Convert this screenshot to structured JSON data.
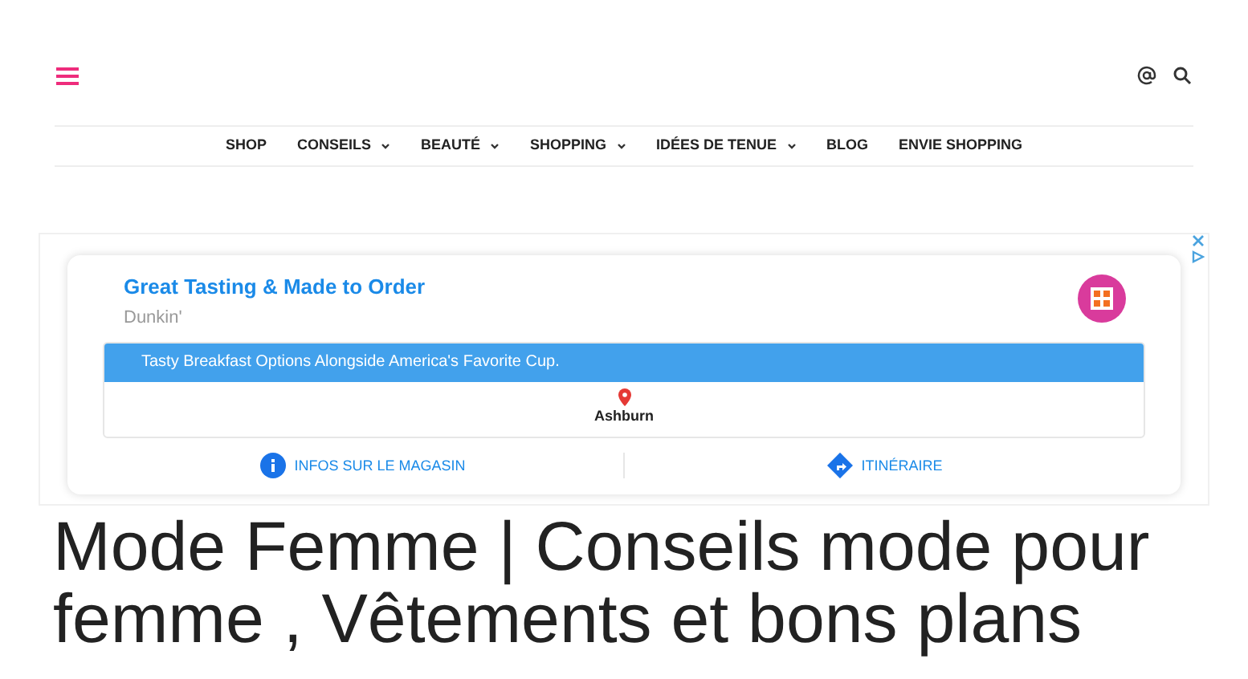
{
  "nav": [
    {
      "label": "SHOP",
      "dropdown": false
    },
    {
      "label": "CONSEILS",
      "dropdown": true
    },
    {
      "label": "BEAUTÉ",
      "dropdown": true
    },
    {
      "label": "SHOPPING",
      "dropdown": true
    },
    {
      "label": "IDÉES DE TENUE",
      "dropdown": true
    },
    {
      "label": "BLOG",
      "dropdown": false
    },
    {
      "label": "ENVIE SHOPPING",
      "dropdown": false
    }
  ],
  "ad": {
    "headline": "Great Tasting & Made to Order",
    "advertiser": "Dunkin'",
    "banner": "Tasty Breakfast Options Alongside America's Favorite Cup.",
    "location": "Ashburn",
    "actions": [
      {
        "kind": "info",
        "label": "INFOS SUR LE MAGASIN"
      },
      {
        "kind": "directions",
        "label": "ITINÉRAIRE"
      }
    ]
  },
  "title": "Mode Femme | Conseils mode pour femme , Vêtements et bons plans"
}
